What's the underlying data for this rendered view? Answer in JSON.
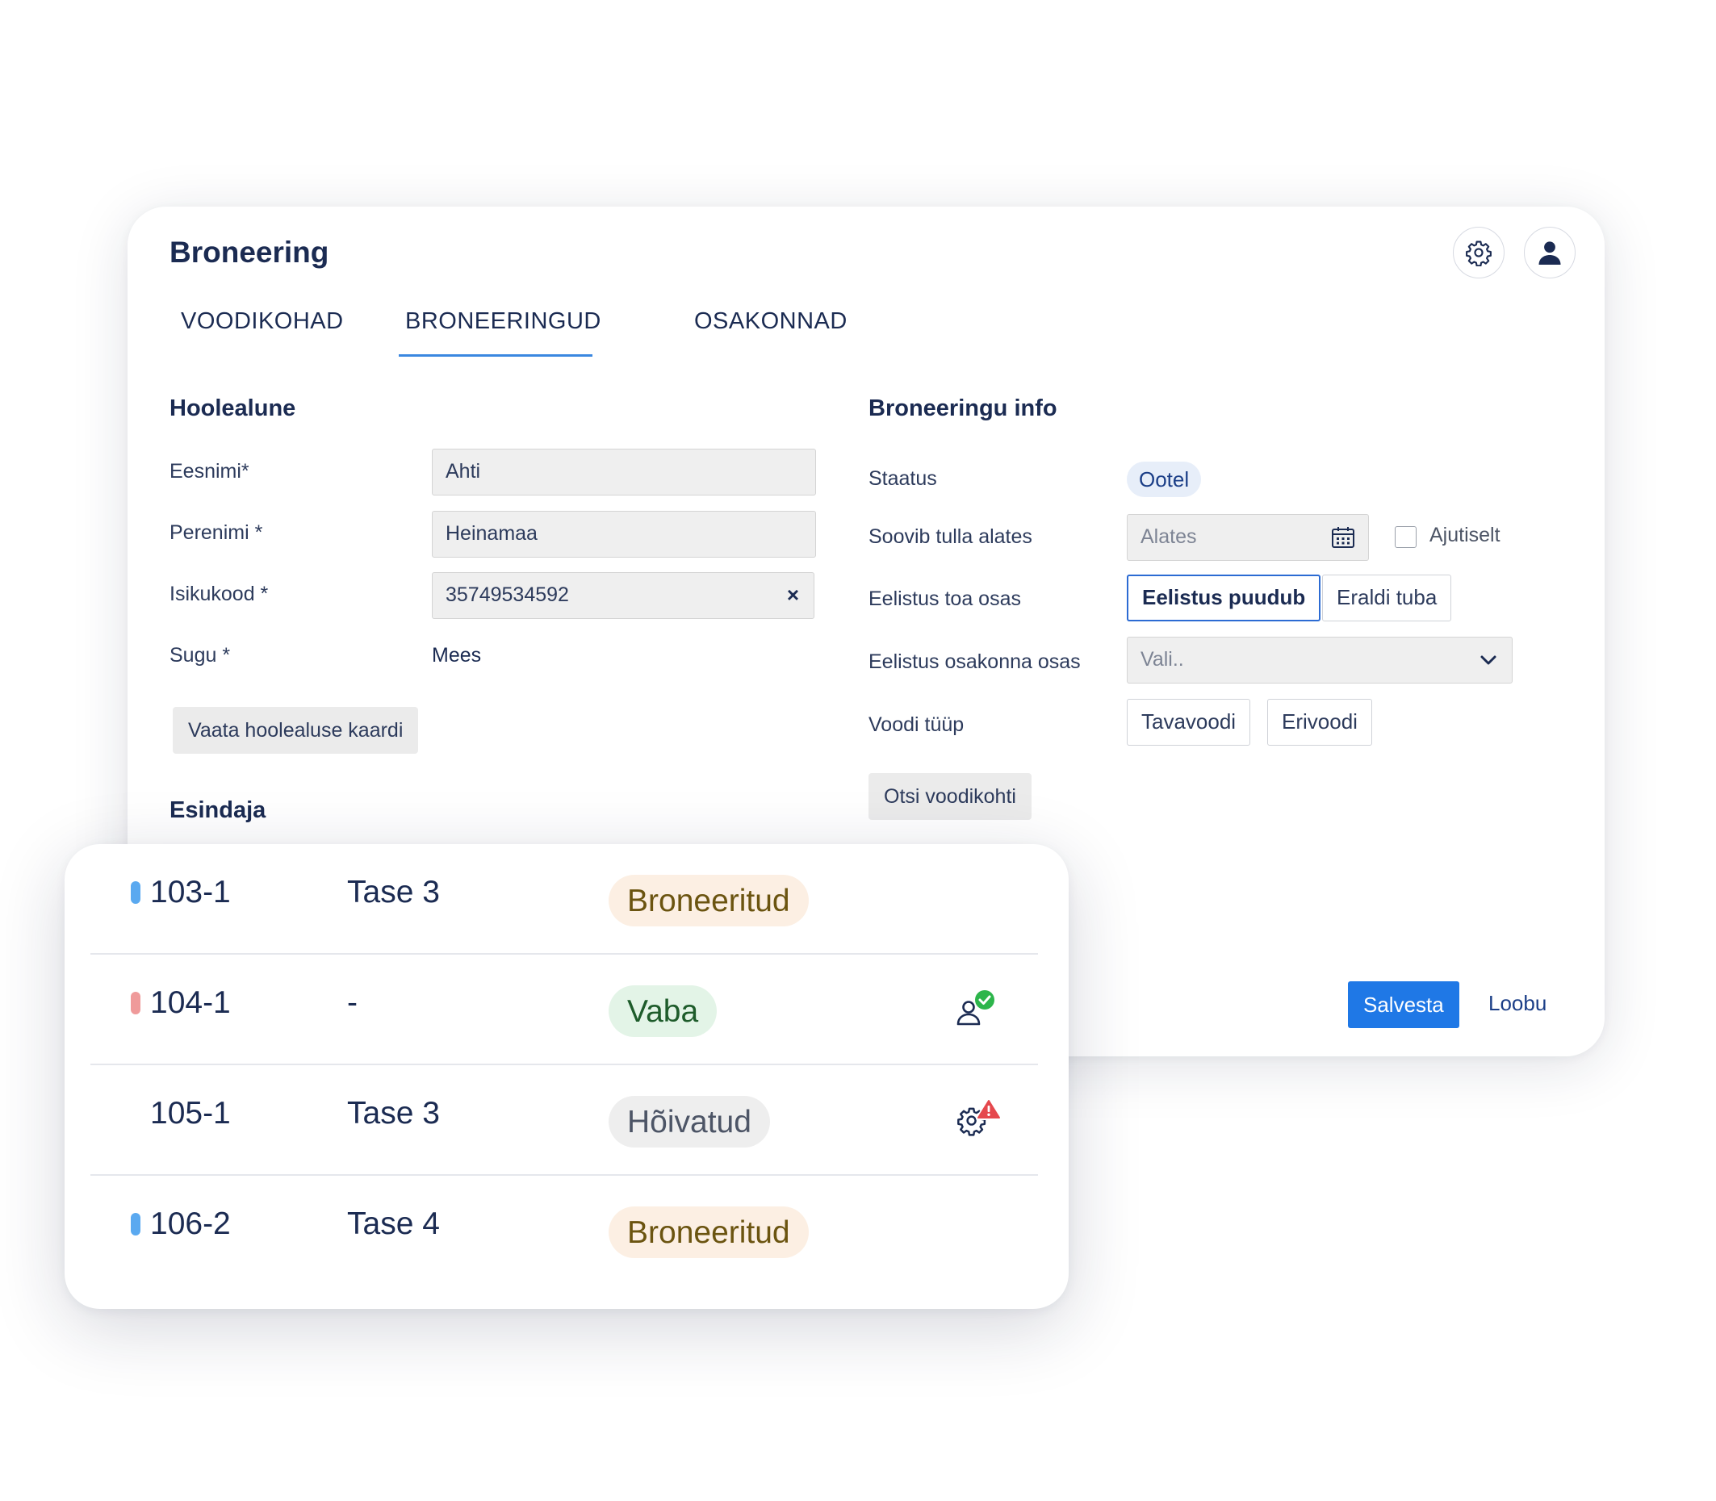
{
  "header": {
    "title": "Broneering",
    "settings_icon": "gear-icon",
    "user_icon": "user-icon"
  },
  "tabs": [
    {
      "label": "VOODIKOHAD",
      "active": false
    },
    {
      "label": "BRONEERINGUD",
      "active": true
    },
    {
      "label": "OSAKONNAD",
      "active": false
    }
  ],
  "ward": {
    "heading": "Hoolealune",
    "first_name": {
      "label": "Eesnimi*",
      "value": "Ahti"
    },
    "last_name": {
      "label": "Perenimi *",
      "value": "Heinamaa"
    },
    "id_code": {
      "label": "Isikukood *",
      "value": "35749534592",
      "clear": "×"
    },
    "gender": {
      "label": "Sugu *",
      "value": "Mees"
    },
    "view_card_button": "Vaata hoolealuse kaardi",
    "representative_heading": "Esindaja"
  },
  "booking": {
    "heading": "Broneeringu info",
    "status": {
      "label": "Staatus",
      "value": "Ootel"
    },
    "wants_from": {
      "label": "Soovib tulla alates",
      "placeholder": "Alates",
      "temporary_label": "Ajutiselt",
      "temporary_checked": false
    },
    "room_pref": {
      "label": "Eelistus toa osas",
      "options": [
        "Eelistus puudub",
        "Eraldi tuba"
      ],
      "selected": "Eelistus puudub"
    },
    "dept_pref": {
      "label": "Eelistus osakonna osas",
      "placeholder": "Vali.."
    },
    "bed_type": {
      "label": "Voodi tüüp",
      "options": [
        "Tavavoodi",
        "Erivoodi"
      ]
    },
    "search_button": "Otsi voodikohti"
  },
  "footer": {
    "save": "Salvesta",
    "cancel": "Loobu"
  },
  "colors": {
    "accent": "#1f78e6",
    "tab_underline": "#3a87e0",
    "booked_bg": "#fcefe3",
    "booked_text": "#6b5410",
    "free_bg": "#e3f4e7",
    "free_text": "#1e5c2b",
    "occupied_bg": "#eeeeee",
    "occupied_text": "#4d5566"
  },
  "beds": [
    {
      "id": "103-1",
      "level": "Tase 3",
      "status": "Broneeritud",
      "marker": "#5aa9f0",
      "icon": ""
    },
    {
      "id": "104-1",
      "level": "-",
      "status": "Vaba",
      "marker": "#ef9a9a",
      "icon": "person-check-icon"
    },
    {
      "id": "105-1",
      "level": "Tase 3",
      "status": "Hõivatud",
      "marker": "",
      "icon": "gear-warning-icon"
    },
    {
      "id": "106-2",
      "level": "Tase 4",
      "status": "Broneeritud",
      "marker": "#5aa9f0",
      "icon": ""
    }
  ]
}
